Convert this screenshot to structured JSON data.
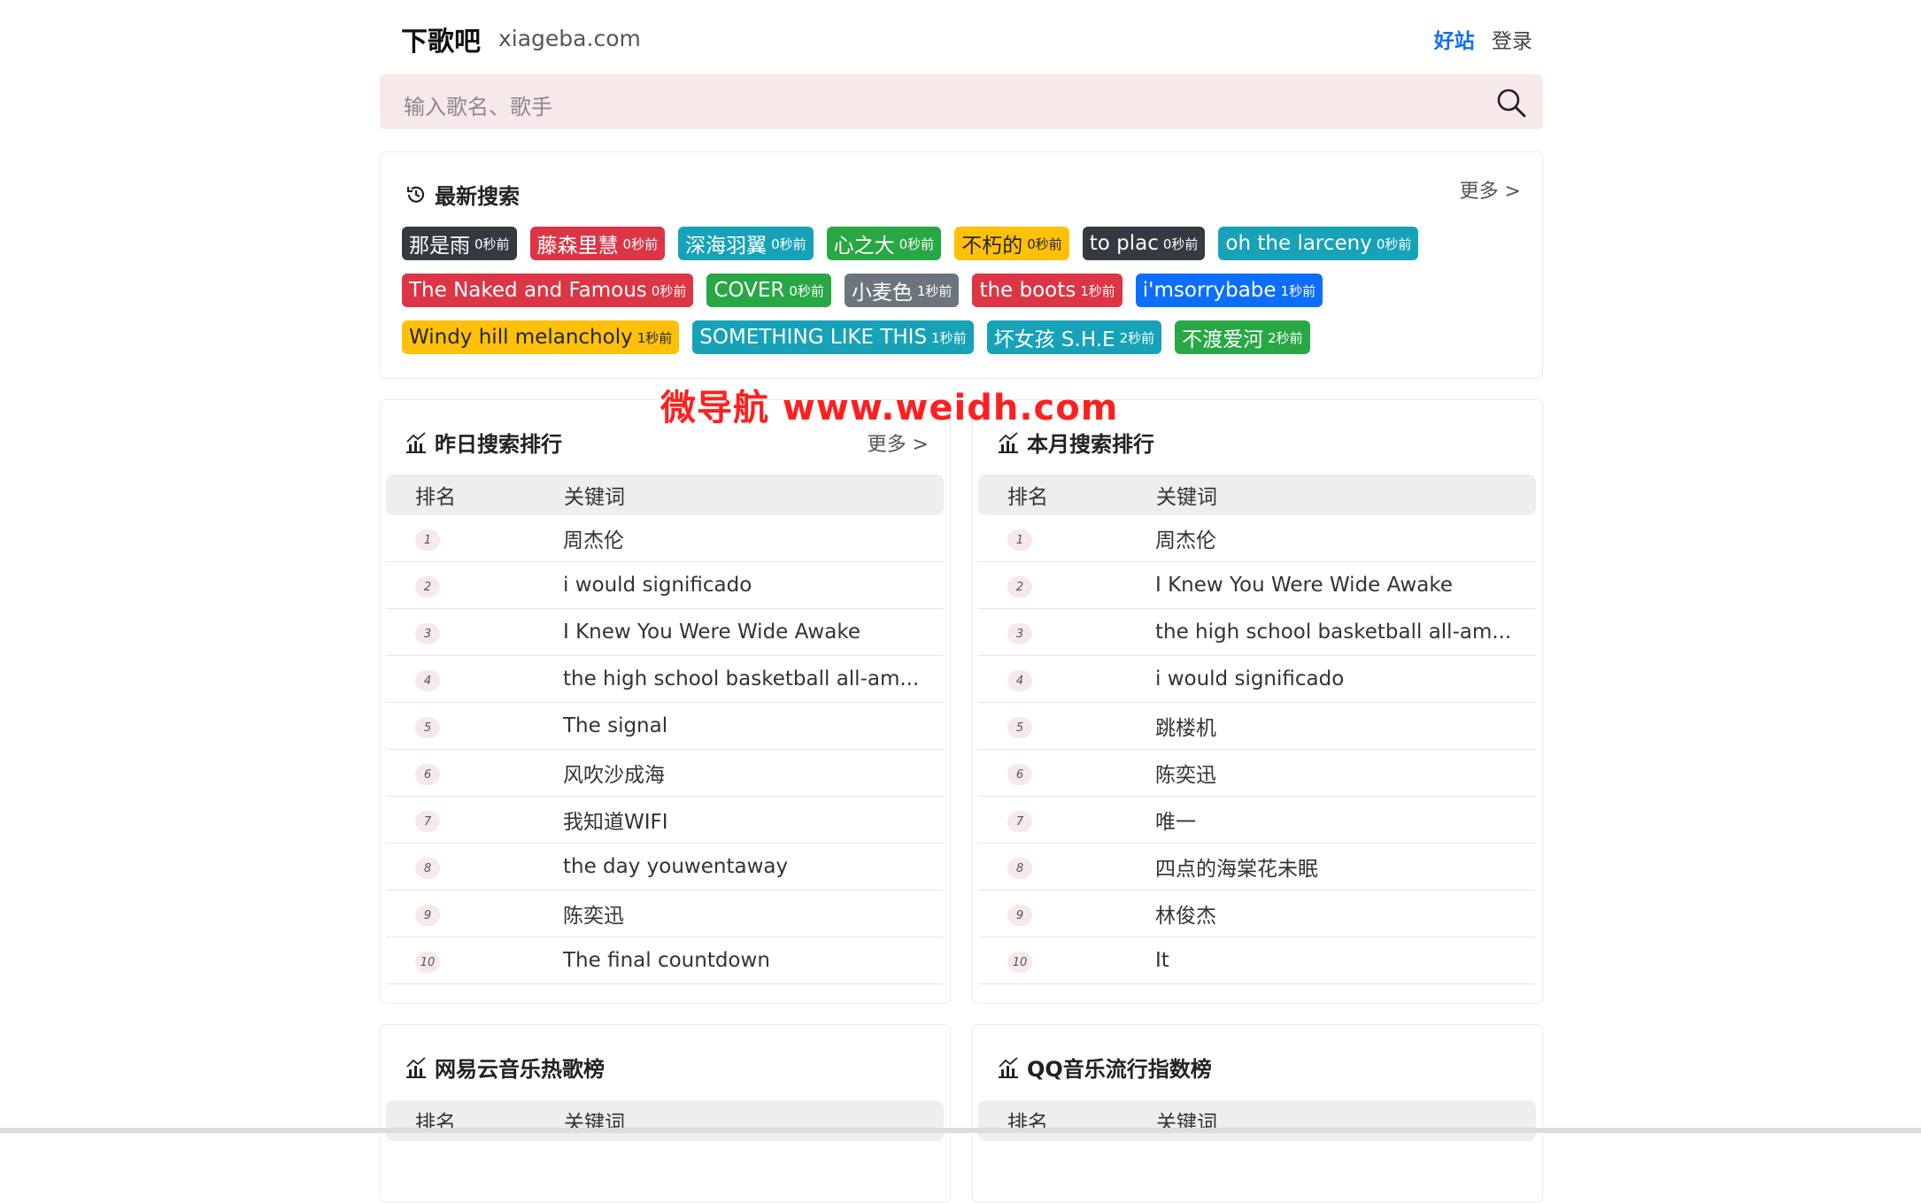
{
  "header": {
    "logo": "下歌吧",
    "domain": "xiageba.com",
    "good_sites": "好站",
    "login": "登录"
  },
  "search": {
    "placeholder": "输入歌名、歌手"
  },
  "recent": {
    "title": "最新搜索",
    "more": "更多 >",
    "rows": [
      [
        {
          "text": "那是雨",
          "time": "0秒前",
          "color": "#343a40"
        },
        {
          "text": "藤森里慧",
          "time": "0秒前",
          "color": "#dc3545"
        },
        {
          "text": "深海羽翼",
          "time": "0秒前",
          "color": "#17a2b8"
        },
        {
          "text": "心之大",
          "time": "0秒前",
          "color": "#28a745"
        },
        {
          "text": "不朽的",
          "time": "0秒前",
          "color": "#ffc107"
        },
        {
          "text": "to plac",
          "time": "0秒前",
          "color": "#343a40"
        },
        {
          "text": "oh the larceny",
          "time": "0秒前",
          "color": "#17a2b8"
        }
      ],
      [
        {
          "text": "The Naked and Famous",
          "time": "0秒前",
          "color": "#dc3545"
        },
        {
          "text": "COVER",
          "time": "0秒前",
          "color": "#28a745"
        },
        {
          "text": "小麦色",
          "time": "1秒前",
          "color": "#6c757d"
        },
        {
          "text": "the boots",
          "time": "1秒前",
          "color": "#dc3545"
        },
        {
          "text": "i'msorrybabe",
          "time": "1秒前",
          "color": "#0d6efd"
        }
      ],
      [
        {
          "text": "Windy hill melancholy",
          "time": "1秒前",
          "color": "#ffc107"
        },
        {
          "text": "SOMETHING LIKE THIS",
          "time": "1秒前",
          "color": "#17a2b8"
        },
        {
          "text": "坏女孩 S.H.E",
          "time": "2秒前",
          "color": "#17a2b8"
        },
        {
          "text": "不渡爱河",
          "time": "2秒前",
          "color": "#28a745"
        }
      ]
    ]
  },
  "watermark": "微导航 www.weidh.com",
  "yesterday": {
    "title": "昨日搜索排行",
    "more": "更多 >",
    "col_rank": "排名",
    "col_keyword": "关键词",
    "rows": [
      {
        "rank": "1",
        "keyword": "周杰伦"
      },
      {
        "rank": "2",
        "keyword": "i would significado"
      },
      {
        "rank": "3",
        "keyword": "I Knew You Were Wide Awake"
      },
      {
        "rank": "4",
        "keyword": "the high school basketball all-am..."
      },
      {
        "rank": "5",
        "keyword": "The signal"
      },
      {
        "rank": "6",
        "keyword": "风吹沙成海"
      },
      {
        "rank": "7",
        "keyword": "我知道WIFI"
      },
      {
        "rank": "8",
        "keyword": "the day youwentaway"
      },
      {
        "rank": "9",
        "keyword": "陈奕迅"
      },
      {
        "rank": "10",
        "keyword": "The final countdown"
      }
    ]
  },
  "month": {
    "title": "本月搜索排行",
    "col_rank": "排名",
    "col_keyword": "关键词",
    "rows": [
      {
        "rank": "1",
        "keyword": "周杰伦"
      },
      {
        "rank": "2",
        "keyword": "I Knew You Were Wide Awake"
      },
      {
        "rank": "3",
        "keyword": "the high school basketball all-am..."
      },
      {
        "rank": "4",
        "keyword": "i would significado"
      },
      {
        "rank": "5",
        "keyword": "跳楼机"
      },
      {
        "rank": "6",
        "keyword": "陈奕迅"
      },
      {
        "rank": "7",
        "keyword": "唯一"
      },
      {
        "rank": "8",
        "keyword": "四点的海棠花未眠"
      },
      {
        "rank": "9",
        "keyword": "林俊杰"
      },
      {
        "rank": "10",
        "keyword": "It"
      }
    ]
  },
  "netease": {
    "title": "网易云音乐热歌榜",
    "col_rank": "排名",
    "col_keyword": "关键词"
  },
  "qq": {
    "title": "QQ音乐流行指数榜",
    "col_rank": "排名",
    "col_keyword": "关键词"
  }
}
